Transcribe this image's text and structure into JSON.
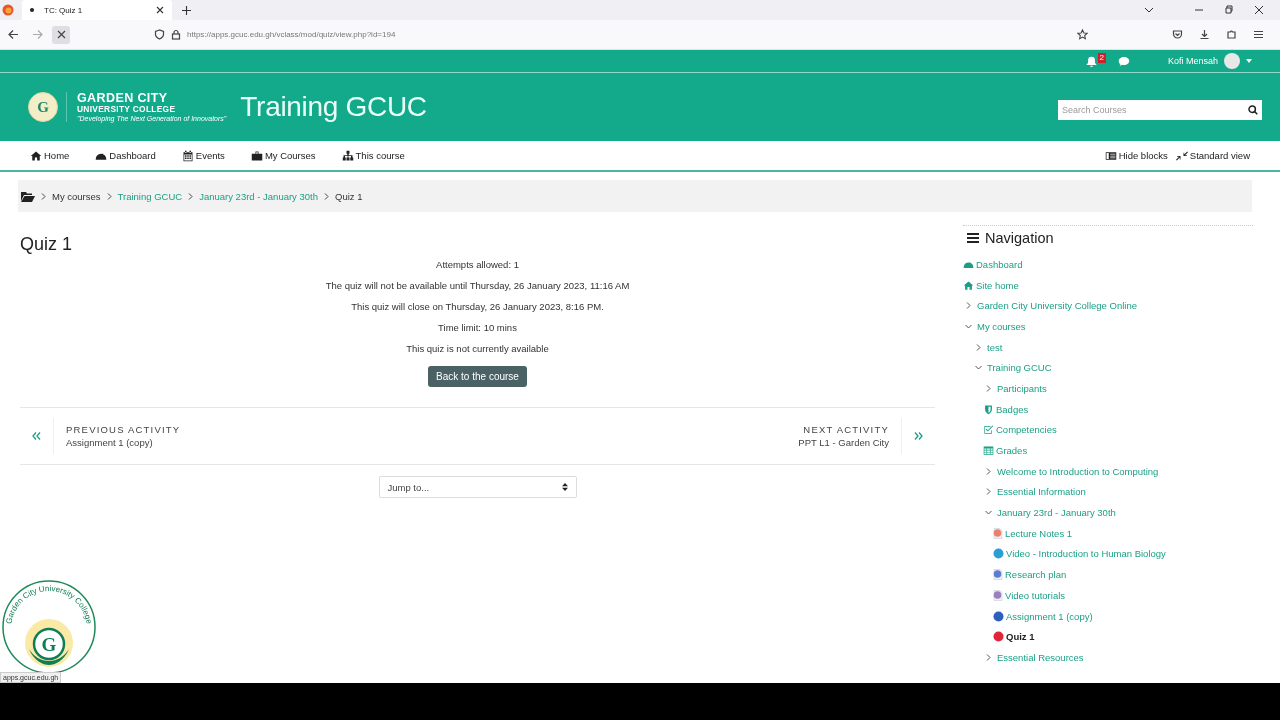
{
  "browser": {
    "tab": {
      "title": "TC: Quiz 1"
    },
    "url": "https://apps.gcuc.edu.gh/vclass/mod/quiz/view.php?id=194",
    "status_url": "apps.gcuc.edu.gh"
  },
  "topbar": {
    "notification_count": "2",
    "user": "Kofi Mensah"
  },
  "header": {
    "logo": {
      "letter": "G",
      "name": "GARDEN CITY",
      "subtitle": "UNIVERSITY COLLEGE",
      "tagline": "\"Developing The Next Generation of Innovators\""
    },
    "site_title": "Training GCUC",
    "search": {
      "placeholder": "Search Courses"
    }
  },
  "nav": {
    "items": [
      {
        "label": "Home"
      },
      {
        "label": "Dashboard"
      },
      {
        "label": "Events"
      },
      {
        "label": "My Courses"
      },
      {
        "label": "This course"
      }
    ],
    "actions": [
      {
        "label": "Hide blocks"
      },
      {
        "label": "Standard view"
      }
    ]
  },
  "breadcrumb": [
    {
      "label": "My courses",
      "kind": "text"
    },
    {
      "label": "Training GCUC",
      "kind": "link"
    },
    {
      "label": "January 23rd - January 30th",
      "kind": "link"
    },
    {
      "label": "Quiz 1",
      "kind": "text"
    }
  ],
  "quiz": {
    "title": "Quiz 1",
    "info": [
      "Attempts allowed: 1",
      "The quiz will not be available until Thursday, 26 January 2023, 11:16 AM",
      "This quiz will close on Thursday, 26 January 2023, 8:16 PM.",
      "Time limit: 10 mins",
      "This quiz is not currently available"
    ],
    "button": "Back to the course",
    "previous": {
      "heading": "PREVIOUS ACTIVITY",
      "name": "Assignment 1 (copy)"
    },
    "next": {
      "heading": "NEXT ACTIVITY",
      "name": "PPT L1 - Garden City"
    },
    "jump": {
      "value": "Jump to..."
    }
  },
  "navigation": {
    "title": "Navigation",
    "items": [
      {
        "label": "Dashboard",
        "kind": "dashboard",
        "selected": false
      },
      {
        "label": "Site home",
        "kind": "home",
        "selected": false
      },
      {
        "label": "Garden City University College Online",
        "kind": "branch",
        "expanded": false,
        "selected": false
      },
      {
        "label": "My courses",
        "kind": "branch",
        "expanded": true,
        "selected": false,
        "children": [
          {
            "label": "test",
            "kind": "branch",
            "expanded": false,
            "selected": false
          },
          {
            "label": "Training GCUC",
            "kind": "branch",
            "expanded": true,
            "selected": false,
            "children": [
              {
                "label": "Participants",
                "kind": "branch",
                "expanded": false,
                "selected": false
              },
              {
                "label": "Badges",
                "kind": "badges",
                "selected": false
              },
              {
                "label": "Competencies",
                "kind": "competencies",
                "selected": false
              },
              {
                "label": "Grades",
                "kind": "grades",
                "selected": false
              },
              {
                "label": "Welcome to Introduction to Computing",
                "kind": "branch",
                "expanded": false,
                "selected": false
              },
              {
                "label": "Essential Information",
                "kind": "branch",
                "expanded": false,
                "selected": false
              },
              {
                "label": "January 23rd - January 30th",
                "kind": "branch",
                "expanded": true,
                "selected": false,
                "children": [
                  {
                    "label": "Lecture Notes 1",
                    "kind": "file",
                    "color": "#e8826f",
                    "selected": false
                  },
                  {
                    "label": "Video - Introduction to Human Biology",
                    "kind": "activity",
                    "color": "#2a9fd6",
                    "selected": false
                  },
                  {
                    "label": "Research plan",
                    "kind": "file",
                    "color": "#5b7bd5",
                    "selected": false
                  },
                  {
                    "label": "Video tutorials",
                    "kind": "file",
                    "color": "#9b7fc0",
                    "selected": false
                  },
                  {
                    "label": "Assignment 1 (copy)",
                    "kind": "activity",
                    "color": "#2d5fbf",
                    "selected": false
                  },
                  {
                    "label": "Quiz 1",
                    "kind": "activity",
                    "color": "#e0243a",
                    "selected": true
                  }
                ]
              },
              {
                "label": "Essential Resources",
                "kind": "branch",
                "expanded": false,
                "selected": false
              }
            ]
          }
        ]
      }
    ]
  },
  "seal": {
    "letter": "G",
    "caption": "Garden City University College"
  }
}
